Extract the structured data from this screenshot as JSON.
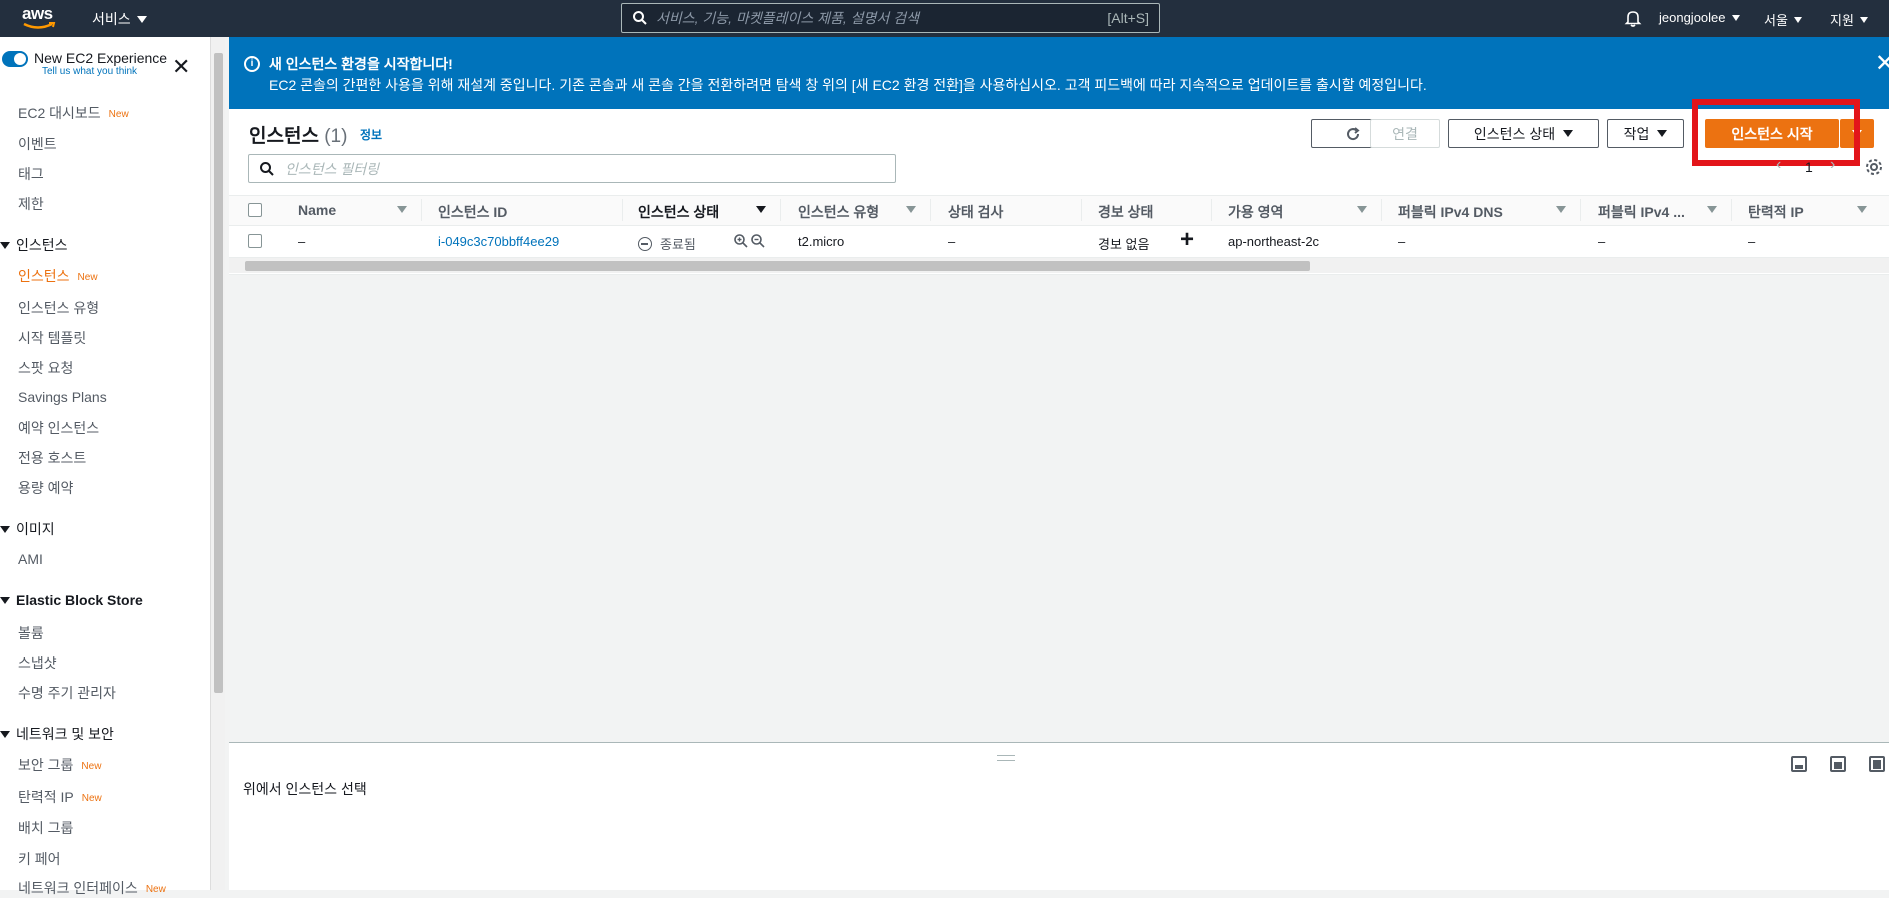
{
  "topbar": {
    "logo": "aws",
    "services": "서비스",
    "search_placeholder": "서비스, 기능, 마켓플레이스 제품, 설명서 검색",
    "search_shortcut": "[Alt+S]",
    "user": "jeongjoolee",
    "region": "서울",
    "support": "지원"
  },
  "sidebar": {
    "experience_title": "New EC2 Experience",
    "experience_sub": "Tell us what you think",
    "dashboard": "EC2 대시보드",
    "dashboard_badge": "New",
    "events": "이벤트",
    "tags": "태그",
    "limits": "제한",
    "instances_section": "인스턴스",
    "instances": "인스턴스",
    "instances_badge": "New",
    "instance_types": "인스턴스 유형",
    "launch_templates": "시작 템플릿",
    "spot_requests": "스팟 요청",
    "savings_plans": "Savings Plans",
    "reserved_instances": "예약 인스턴스",
    "dedicated_hosts": "전용 호스트",
    "capacity_reservations": "용량 예약",
    "images_section": "이미지",
    "ami": "AMI",
    "ebs_section": "Elastic Block Store",
    "volumes": "볼륨",
    "snapshots": "스냅샷",
    "lifecycle_manager": "수명 주기 관리자",
    "network_section": "네트워크 및 보안",
    "security_groups": "보안 그룹",
    "security_groups_badge": "New",
    "elastic_ips": "탄력적 IP",
    "elastic_ips_badge": "New",
    "placement_groups": "배치 그룹",
    "key_pairs": "키 페어",
    "network_interfaces": "네트워크 인터페이스",
    "network_interfaces_badge": "New"
  },
  "banner": {
    "title": "새 인스턴스 환경을 시작합니다!",
    "message": "EC2 콘솔의 간편한 사용을 위해 재설계 중입니다. 기존 콘솔과 새 콘솔 간을 전환하려면 탐색 창 위의 [새 EC2 환경 전환]을 사용하십시오. 고객 피드백에 따라 지속적으로 업데이트를 출시할 예정입니다."
  },
  "header": {
    "title": "인스턴스",
    "count": "(1)",
    "info": "정보",
    "connect": "연결",
    "instance_state": "인스턴스 상태",
    "actions": "작업",
    "launch": "인스턴스 시작",
    "filter_placeholder": "인스턴스 필터링",
    "page": "1"
  },
  "table": {
    "columns": [
      "Name",
      "인스턴스 ID",
      "인스턴스 상태",
      "인스턴스 유형",
      "상태 검사",
      "경보 상태",
      "가용 영역",
      "퍼블릭 IPv4 DNS",
      "퍼블릭 IPv4 ...",
      "탄력적 IP"
    ],
    "rows": [
      {
        "name": "–",
        "instance_id": "i-049c3c70bbff4ee29",
        "state": "종료됨",
        "type": "t2.micro",
        "status_check": "–",
        "alarm": "경보 없음",
        "az": "ap-northeast-2c",
        "public_dns": "–",
        "public_ip": "–",
        "elastic_ip": "–"
      }
    ]
  },
  "details": {
    "empty_text": "위에서 인스턴스 선택"
  },
  "colors": {
    "topbar": "#232f3e",
    "banner": "#0073bb",
    "primary": "#ec7211",
    "highlight": "#e3151a"
  }
}
